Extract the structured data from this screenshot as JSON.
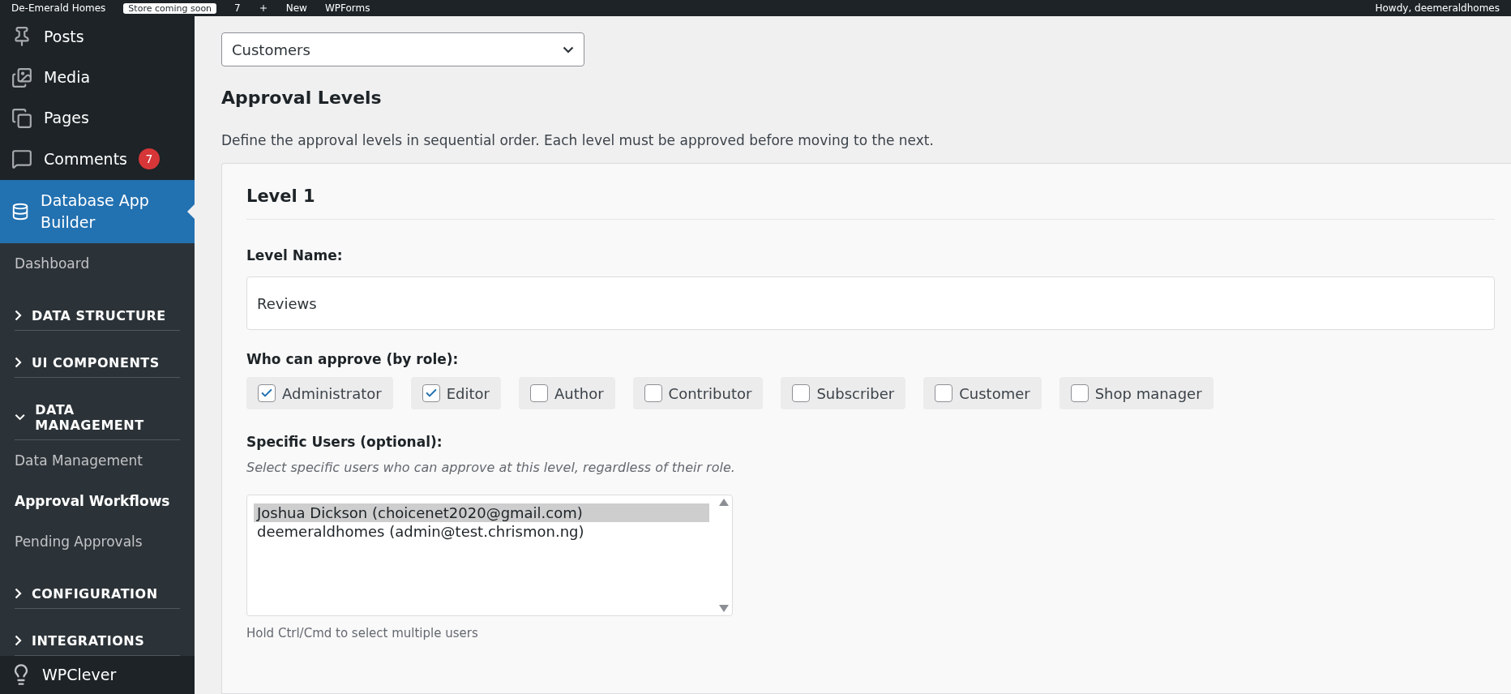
{
  "admin_bar": {
    "site": "De-Emerald Homes",
    "store_badge": "Store coming soon",
    "comments_count": "7",
    "new_label": "New",
    "wpforms_label": "WPForms",
    "greeting": "Howdy, deemeraldhomes"
  },
  "sidebar": {
    "items": [
      {
        "kind": "menu",
        "label": "Posts",
        "selected": false
      },
      {
        "kind": "menu",
        "label": "Media",
        "selected": false
      },
      {
        "kind": "menu",
        "label": "Pages",
        "selected": false
      },
      {
        "kind": "menu",
        "label": "Comments",
        "badge": "7",
        "selected": false
      },
      {
        "kind": "menu",
        "label": "Database App Builder",
        "selected": true
      },
      {
        "kind": "sub",
        "label": "Dashboard",
        "selected": false
      },
      {
        "kind": "section",
        "label": "DATA STRUCTURE",
        "expanded": false
      },
      {
        "kind": "section",
        "label": "UI COMPONENTS",
        "expanded": false
      },
      {
        "kind": "section",
        "label": "DATA MANAGEMENT",
        "expanded": true
      },
      {
        "kind": "sub",
        "label": "Data Management",
        "selected": false
      },
      {
        "kind": "sub",
        "label": "Approval Workflows",
        "selected": true
      },
      {
        "kind": "sub",
        "label": "Pending Approvals",
        "selected": false
      },
      {
        "kind": "section",
        "label": "CONFIGURATION",
        "expanded": false
      },
      {
        "kind": "section",
        "label": "INTEGRATIONS",
        "expanded": false
      },
      {
        "kind": "footer",
        "label": "WPClever",
        "selected": false
      }
    ]
  },
  "table_select": {
    "value": "Customers"
  },
  "heading": "Approval Levels",
  "description": "Define the approval levels in sequential order. Each level must be approved before moving to the next.",
  "level": {
    "title": "Level 1",
    "name_label": "Level Name:",
    "name_value": "Reviews",
    "roles_label": "Who can approve (by role):",
    "roles": [
      {
        "label": "Administrator",
        "checked": true
      },
      {
        "label": "Editor",
        "checked": true
      },
      {
        "label": "Author",
        "checked": false
      },
      {
        "label": "Contributor",
        "checked": false
      },
      {
        "label": "Subscriber",
        "checked": false
      },
      {
        "label": "Customer",
        "checked": false
      },
      {
        "label": "Shop manager",
        "checked": false
      }
    ],
    "users_label": "Specific Users (optional):",
    "users_hint": "Select specific users who can approve at this level, regardless of their role.",
    "users": [
      {
        "label": "Joshua Dickson (choicenet2020@gmail.com)",
        "selected": true
      },
      {
        "label": "deemeraldhomes (admin@test.chrismon.ng)",
        "selected": false
      }
    ],
    "users_help": "Hold Ctrl/Cmd to select multiple users"
  }
}
